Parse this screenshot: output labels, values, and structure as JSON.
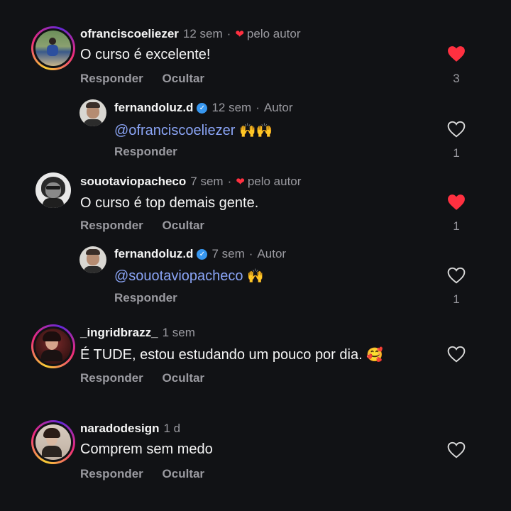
{
  "comments": [
    {
      "username": "ofranciscoeliezer",
      "time": "12 sem",
      "liked_by_author": "pelo autor",
      "text": "O curso é excelente!",
      "reply_label": "Responder",
      "hide_label": "Ocultar",
      "likes": "3",
      "liked": true,
      "replies": [
        {
          "username": "fernandoluz.d",
          "time": "12 sem",
          "role": "Autor",
          "mention": "@ofranciscoeliezer",
          "emoji": "🙌🙌",
          "reply_label": "Responder",
          "likes": "1"
        }
      ]
    },
    {
      "username": "souotaviopacheco",
      "time": "7 sem",
      "liked_by_author": "pelo autor",
      "text": "O curso é top demais gente.",
      "reply_label": "Responder",
      "hide_label": "Ocultar",
      "likes": "1",
      "liked": true,
      "replies": [
        {
          "username": "fernandoluz.d",
          "time": "7 sem",
          "role": "Autor",
          "mention": "@souotaviopacheco",
          "emoji": "🙌",
          "reply_label": "Responder",
          "likes": "1"
        }
      ]
    },
    {
      "username": "_ingridbrazz_",
      "time": "1 sem",
      "text": "É TUDE, estou estudando um pouco por dia.",
      "emoji": "🥰",
      "reply_label": "Responder",
      "hide_label": "Ocultar",
      "liked": false
    },
    {
      "username": "naradodesign",
      "time": "1 d",
      "text": "Comprem sem medo",
      "reply_label": "Responder",
      "hide_label": "Ocultar",
      "liked": false
    }
  ],
  "colors": {
    "background": "#111215",
    "like_red": "#ff3040",
    "mention_blue": "#8aa4f5",
    "verified_blue": "#3797f0",
    "muted_text": "#9a9aa0"
  },
  "icons": {
    "heart_filled": "heart-filled-icon",
    "heart_outline": "heart-outline-icon",
    "verified": "verified-badge-icon"
  }
}
